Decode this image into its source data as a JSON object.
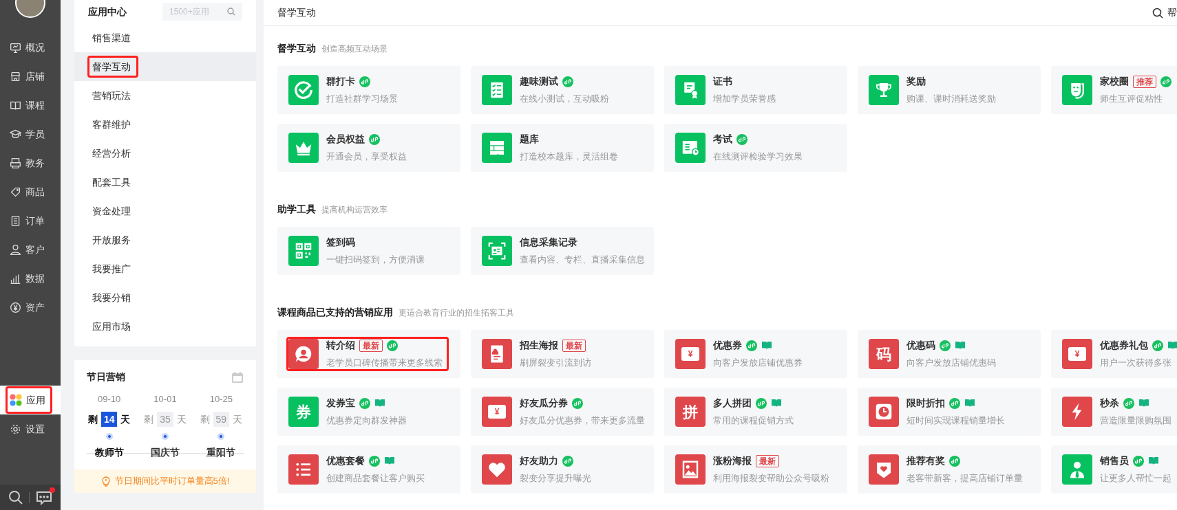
{
  "sidebar": {
    "nav": [
      {
        "label": "概况",
        "kind": "monitor",
        "selected": false,
        "annotated": false
      },
      {
        "label": "店铺",
        "kind": "store",
        "selected": false,
        "annotated": false
      },
      {
        "label": "课程",
        "kind": "book",
        "selected": false,
        "annotated": false
      },
      {
        "label": "学员",
        "kind": "cap",
        "selected": false,
        "annotated": false
      },
      {
        "label": "教务",
        "kind": "printer",
        "selected": false,
        "annotated": false
      },
      {
        "label": "商品",
        "kind": "tag",
        "selected": false,
        "annotated": false
      },
      {
        "label": "订单",
        "kind": "doc",
        "selected": false,
        "annotated": false
      },
      {
        "label": "客户",
        "kind": "user",
        "selected": false,
        "annotated": false
      },
      {
        "label": "数据",
        "kind": "bars",
        "selected": false,
        "annotated": false
      },
      {
        "label": "资产",
        "kind": "yen",
        "selected": false,
        "annotated": false
      },
      {
        "label": "应用",
        "kind": "apps",
        "selected": true,
        "annotated": true
      },
      {
        "label": "设置",
        "kind": "gear",
        "selected": false,
        "annotated": false
      }
    ],
    "messages_unread": true
  },
  "submenu": {
    "title": "应用中心",
    "search": {
      "placeholder": "1500+应用"
    },
    "items": [
      {
        "label": "销售渠道",
        "selected": false,
        "annotated": false
      },
      {
        "label": "督学互动",
        "selected": true,
        "annotated": true
      },
      {
        "label": "营销玩法",
        "selected": false,
        "annotated": false
      },
      {
        "label": "客群维护",
        "selected": false,
        "annotated": false
      },
      {
        "label": "经营分析",
        "selected": false,
        "annotated": false
      },
      {
        "label": "配套工具",
        "selected": false,
        "annotated": false
      },
      {
        "label": "资金处理",
        "selected": false,
        "annotated": false
      },
      {
        "label": "开放服务",
        "selected": false,
        "annotated": false
      },
      {
        "label": "我要推广",
        "selected": false,
        "annotated": false
      },
      {
        "label": "我要分销",
        "selected": false,
        "annotated": false
      },
      {
        "label": "应用市场",
        "selected": false,
        "annotated": false
      }
    ]
  },
  "holiday": {
    "title": "节日营销",
    "holidays": [
      {
        "date": "09-10",
        "prefix": "剩",
        "days": "14",
        "suffix": "天",
        "name": "教师节",
        "selected": true
      },
      {
        "date": "10-01",
        "prefix": "剩",
        "days": "35",
        "suffix": "天",
        "name": "国庆节",
        "selected": false
      },
      {
        "date": "10-25",
        "prefix": "剩",
        "days": "59",
        "suffix": "天",
        "name": "重阳节",
        "selected": false
      }
    ],
    "tip": "节日期间比平时订单量高5倍!"
  },
  "main": {
    "title": "督学互动",
    "help": "帮",
    "sections": [
      {
        "title": "督学互动",
        "subtitle": "创造高频互动场景",
        "apps": [
          {
            "title": "群打卡",
            "desc": "打造社群学习场景",
            "kind": "check",
            "color": "#07c160",
            "mini_program": true,
            "course_book": false,
            "annotated": false
          },
          {
            "title": "趣味测试",
            "desc": "在线小测试，互动吸粉",
            "kind": "checklist",
            "color": "#07c160",
            "mini_program": true,
            "course_book": false,
            "annotated": false
          },
          {
            "title": "证书",
            "desc": "增加学员荣誉感",
            "kind": "certificate",
            "color": "#07c160",
            "mini_program": false,
            "course_book": false,
            "annotated": false
          },
          {
            "title": "奖励",
            "desc": "购课、课时消耗送奖励",
            "kind": "trophy",
            "color": "#07c160",
            "mini_program": false,
            "course_book": false,
            "annotated": false
          },
          {
            "title": "家校圈",
            "badge": "推荐",
            "desc": "师生互评促粘性",
            "kind": "mask",
            "color": "#07c160",
            "mini_program": true,
            "course_book": false,
            "annotated": false
          },
          {
            "title": "会员权益",
            "desc": "开通会员，享受权益",
            "kind": "crown",
            "color": "#07c160",
            "mini_program": true,
            "course_book": false,
            "annotated": false
          },
          {
            "title": "题库",
            "desc": "打造校本题库，灵活组卷",
            "kind": "bank",
            "color": "#07c160",
            "mini_program": false,
            "course_book": false,
            "annotated": false
          },
          {
            "title": "考试",
            "desc": "在线测评检验学习效果",
            "kind": "exam",
            "color": "#07c160",
            "mini_program": true,
            "course_book": false,
            "annotated": false
          }
        ]
      },
      {
        "title": "助学工具",
        "subtitle": "提高机构运营效率",
        "apps": [
          {
            "title": "签到码",
            "desc": "一键扫码签到，方便消课",
            "kind": "qr",
            "color": "#07c160",
            "mini_program": false,
            "course_book": false,
            "annotated": false
          },
          {
            "title": "信息采集记录",
            "desc": "查看内容、专栏、直播采集信息",
            "kind": "idcard",
            "color": "#07c160",
            "mini_program": false,
            "course_book": false,
            "annotated": false
          }
        ]
      },
      {
        "title": "课程商品已支持的营销应用",
        "subtitle": "更适合教育行业的招生拓客工具",
        "apps": [
          {
            "title": "转介绍",
            "badge": "最新",
            "desc": "老学员口碑传播带来更多线索",
            "kind": "person",
            "color": "#e0474a",
            "mini_program": true,
            "course_book": false,
            "annotated": true
          },
          {
            "title": "招生海报",
            "badge": "最新",
            "desc": "刷屏裂变引流到访",
            "kind": "poster",
            "color": "#e0474a",
            "mini_program": false,
            "course_book": false,
            "annotated": false
          },
          {
            "title": "优惠券",
            "desc": "向客户发放店铺优惠券",
            "kind": "ticket",
            "glyph": "¥",
            "color": "#e0474a",
            "mini_program": true,
            "course_book": true,
            "annotated": false
          },
          {
            "title": "优惠码",
            "desc": "向客户发放店铺优惠码",
            "kind": "glyph",
            "glyph": "码",
            "color": "#e0474a",
            "mini_program": true,
            "course_book": true,
            "annotated": false
          },
          {
            "title": "优惠券礼包",
            "desc": "用户一次获得多张",
            "kind": "ticket",
            "glyph": "¥",
            "color": "#e0474a",
            "mini_program": true,
            "course_book": true,
            "annotated": false
          },
          {
            "title": "发券宝",
            "desc": "优惠券定向群发神器",
            "kind": "glyph",
            "glyph": "券",
            "color": "#07c160",
            "mini_program": true,
            "course_book": true,
            "annotated": false
          },
          {
            "title": "好友瓜分券",
            "desc": "好友瓜分优惠券，带来更多流量",
            "kind": "ticket",
            "glyph": "¥",
            "color": "#e0474a",
            "mini_program": true,
            "course_book": false,
            "annotated": false
          },
          {
            "title": "多人拼团",
            "desc": "常用的课程促销方式",
            "kind": "glyph",
            "glyph": "拼",
            "color": "#e0474a",
            "mini_program": true,
            "course_book": true,
            "annotated": false
          },
          {
            "title": "限时折扣",
            "desc": "短时间实现课程销量增长",
            "kind": "clock",
            "color": "#e0474a",
            "mini_program": true,
            "course_book": true,
            "annotated": false
          },
          {
            "title": "秒杀",
            "desc": "营造限量限购氛围",
            "kind": "bolt",
            "color": "#e0474a",
            "mini_program": true,
            "course_book": true,
            "annotated": false
          },
          {
            "title": "优惠套餐",
            "desc": "创建商品套餐让客户购买",
            "kind": "list",
            "color": "#e0474a",
            "mini_program": true,
            "course_book": true,
            "annotated": false
          },
          {
            "title": "好友助力",
            "desc": "裂变分享提升曝光",
            "kind": "heart",
            "color": "#e0474a",
            "mini_program": true,
            "course_book": false,
            "annotated": false
          },
          {
            "title": "涨粉海报",
            "badge": "最新",
            "desc": "利用海报裂变帮助公众号吸粉",
            "kind": "image",
            "color": "#e0474a",
            "mini_program": false,
            "course_book": false,
            "annotated": false
          },
          {
            "title": "推荐有奖",
            "desc": "老客带新客，提高店铺订单量",
            "kind": "heartcard",
            "color": "#e0474a",
            "mini_program": true,
            "course_book": false,
            "annotated": false
          },
          {
            "title": "销售员",
            "desc": "让更多人帮忙一起",
            "kind": "staff",
            "color": "#07c160",
            "mini_program": true,
            "course_book": true,
            "annotated": false
          }
        ]
      }
    ]
  }
}
